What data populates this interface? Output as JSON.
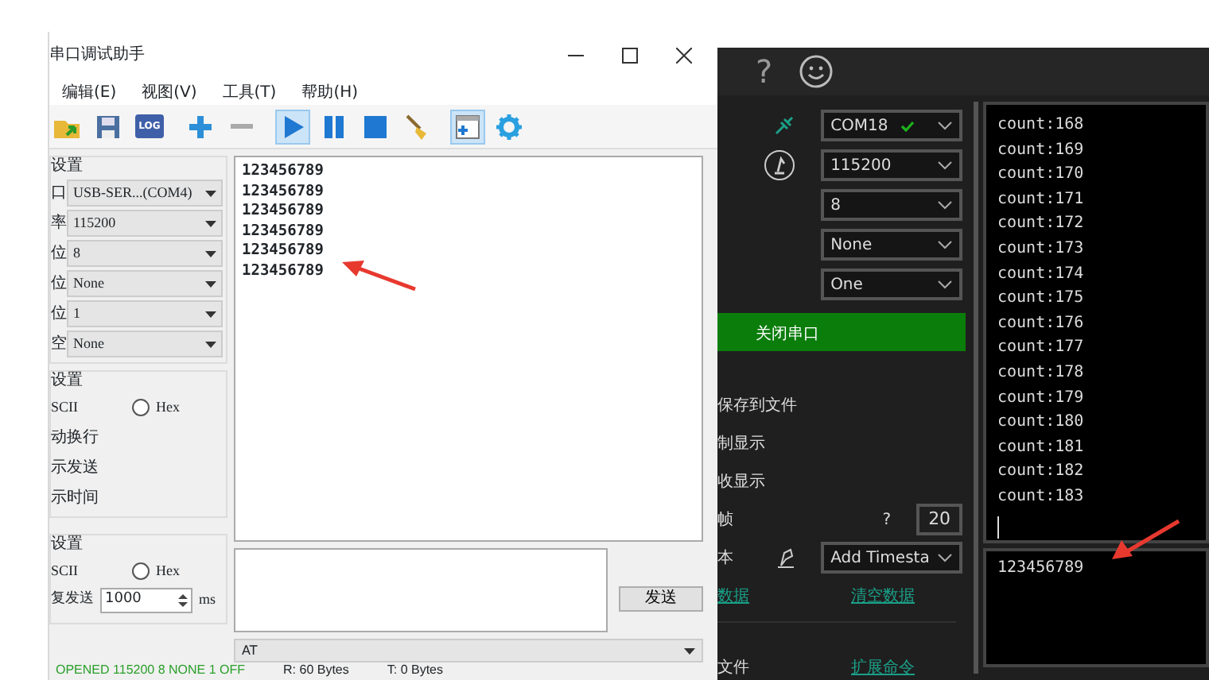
{
  "serial_assistant": {
    "title": "串口调试助手",
    "menu": [
      "编辑(E)",
      "视图(V)",
      "工具(T)",
      "帮助(H)"
    ],
    "toolbar": [
      {
        "kind": "folder",
        "selected": false
      },
      {
        "kind": "save",
        "selected": false
      },
      {
        "kind": "log",
        "label": "LOG",
        "selected": false
      },
      {
        "kind": "plus",
        "selected": false
      },
      {
        "kind": "minus",
        "selected": false
      },
      {
        "kind": "play",
        "selected": true
      },
      {
        "kind": "pause",
        "selected": false
      },
      {
        "kind": "stop",
        "selected": false
      },
      {
        "kind": "broom",
        "selected": false
      },
      {
        "kind": "window",
        "selected": true
      },
      {
        "kind": "gear",
        "selected": false
      }
    ],
    "port_settings": {
      "heading": "设置",
      "fields": [
        {
          "label": "口",
          "value": "USB-SER...(COM4)"
        },
        {
          "label": "率",
          "value": "115200"
        },
        {
          "label": "位",
          "value": "8"
        },
        {
          "label": "位",
          "value": "None"
        },
        {
          "label": "位",
          "value": "1"
        },
        {
          "label": "空",
          "value": "None"
        }
      ]
    },
    "receive_settings": {
      "heading": "设置",
      "encoding": [
        {
          "label": "SCII"
        },
        {
          "label": "Hex",
          "checked": false
        }
      ],
      "options": [
        "动换行",
        "示发送",
        "示时间"
      ]
    },
    "send_settings": {
      "heading": "设置",
      "encoding": [
        {
          "label": "SCII"
        },
        {
          "label": "Hex",
          "checked": false
        }
      ],
      "repeat": {
        "label": "复发送",
        "value": "1000",
        "unit": "ms"
      }
    },
    "received_lines": [
      "123456789",
      "123456789",
      "123456789",
      "123456789",
      "123456789",
      "123456789"
    ],
    "send_button": "发送",
    "send_combo": "AT",
    "status_bar": [
      "OPENED 115200 8 NONE 1 OFF",
      "R: 60 Bytes",
      "T: 0 Bytes"
    ]
  },
  "serial_terminal": {
    "help": "?",
    "port_fields": [
      {
        "kind": "plug",
        "value": "COM18",
        "connected": true
      },
      {
        "kind": "gauge",
        "value": "115200",
        "connected": false
      },
      {
        "kind": "plain",
        "value": "8",
        "connected": false
      },
      {
        "kind": "plain",
        "value": "None",
        "connected": false
      },
      {
        "kind": "plain",
        "value": "One",
        "connected": false
      }
    ],
    "close_button": "关闭串口",
    "options": [
      {
        "kind": "text",
        "label": "保存到文件"
      },
      {
        "kind": "text",
        "label": "制显示"
      },
      {
        "kind": "text",
        "label": "收显示"
      },
      {
        "kind": "number",
        "label": "帧",
        "hint": "?",
        "value": "20"
      },
      {
        "kind": "select",
        "label": "本",
        "value": "Add Timesta"
      }
    ],
    "links": [
      "数据",
      "清空数据"
    ],
    "extra": {
      "label": "文件",
      "link": "扩展命令"
    },
    "terminal_lines": [
      "count:168",
      "count:169",
      "count:170",
      "count:171",
      "count:172",
      "count:173",
      "count:174",
      "count:175",
      "count:176",
      "count:177",
      "count:178",
      "count:179",
      "count:180",
      "count:181",
      "count:182",
      "count:183"
    ],
    "input_text": "123456789"
  }
}
